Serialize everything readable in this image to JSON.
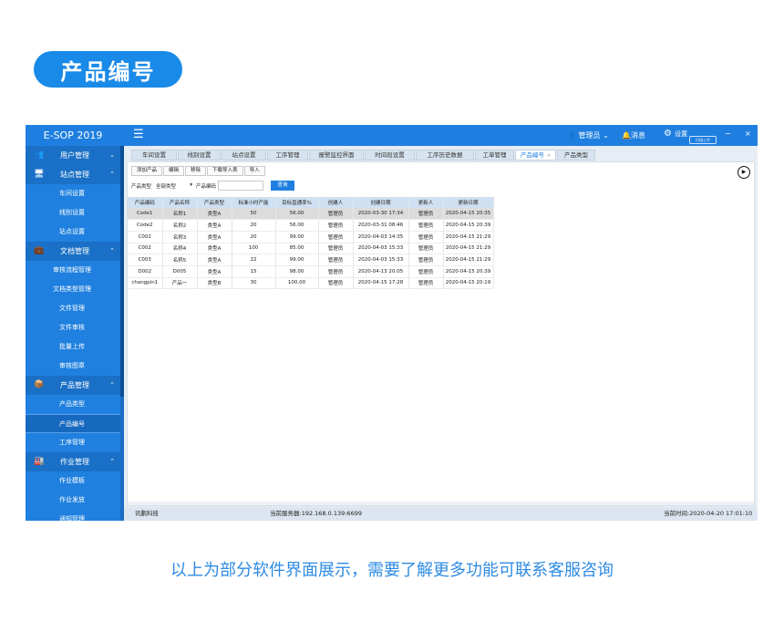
{
  "banner": {
    "title": "产品编号"
  },
  "topbar": {
    "app_title": "E-SOP 2019",
    "menu_glyph": "☰",
    "admin_label": "管理员",
    "messages_label": "消息",
    "settings_label": "设置",
    "shortcut_label": "扫描上传",
    "win_min": "−",
    "win_close": "×"
  },
  "sidebar": {
    "groups": [
      {
        "label": "用户管理",
        "icon": "users-icon",
        "items": []
      },
      {
        "label": "站点管理",
        "icon": "monitor-icon",
        "items": [
          "车间设置",
          "线别设置",
          "站点设置"
        ]
      },
      {
        "label": "文档管理",
        "icon": "briefcase-icon",
        "items": [
          "审核流程管理",
          "文档类型管理",
          "文件管理",
          "文件审核",
          "批量上传",
          "审核图章"
        ]
      },
      {
        "label": "产品管理",
        "icon": "box-icon",
        "items": [
          "产品类型",
          "产品编号",
          "工序管理"
        ]
      },
      {
        "label": "作业管理",
        "icon": "factory-icon",
        "items": [
          "作业模板",
          "作业发放",
          "通知管理"
        ]
      }
    ]
  },
  "tabs": [
    "车间设置",
    "线别设置",
    "站点设置",
    "工序管理",
    "报警监控界面",
    "时间段设置",
    "工序历史数据",
    "工单管理",
    "产品编号",
    "产品类型"
  ],
  "active_tab": "产品编号",
  "toolbar": [
    "添加产品",
    "编辑",
    "移除",
    "下载导入表",
    "导入"
  ],
  "filter": {
    "type_label": "产品类型",
    "type_value": "全部类型",
    "code_label": "产品编码",
    "query_button": "查询"
  },
  "table": {
    "columns": [
      "产品编码",
      "产品名称",
      "产品类型",
      "标准小时产能",
      "目标直通率%",
      "创建人",
      "创建日期",
      "更新人",
      "更新日期"
    ],
    "rows": [
      [
        "Code1",
        "名称1",
        "类型A",
        "50",
        "56.00",
        "管理员",
        "2020-03-30 17:34",
        "管理员",
        "2020-04-15 20:35"
      ],
      [
        "Code2",
        "名称2",
        "类型A",
        "20",
        "56.00",
        "管理员",
        "2020-03-31 08:46",
        "管理员",
        "2020-04-15 20:39"
      ],
      [
        "C001",
        "名称3",
        "类型A",
        "20",
        "99.00",
        "管理员",
        "2020-04-03 14:35",
        "管理员",
        "2020-04-15 21:29"
      ],
      [
        "C002",
        "名称4",
        "类型A",
        "100",
        "85.00",
        "管理员",
        "2020-04-03 15:33",
        "管理员",
        "2020-04-15 21:29"
      ],
      [
        "C003",
        "名称5",
        "类型A",
        "22",
        "99.00",
        "管理员",
        "2020-04-03 15:33",
        "管理员",
        "2020-04-15 21:29"
      ],
      [
        "D002",
        "D005",
        "类型A",
        "15",
        "98.00",
        "管理员",
        "2020-04-13 20:05",
        "管理员",
        "2020-04-15 20:39"
      ],
      [
        "changpin1",
        "产品一",
        "类型B",
        "30",
        "100.00",
        "管理员",
        "2020-04-15 17:28",
        "管理员",
        "2020-04-15 20:19"
      ]
    ]
  },
  "statusbar": {
    "company": "讯鹏科技",
    "server": "当前服务器:192.168.0.139:6699",
    "time": "当前时间:2020-04-20 17:01:10"
  },
  "footer": {
    "text": "以上为部分软件界面展示，需要了解更多功能可联系客服咨询"
  }
}
